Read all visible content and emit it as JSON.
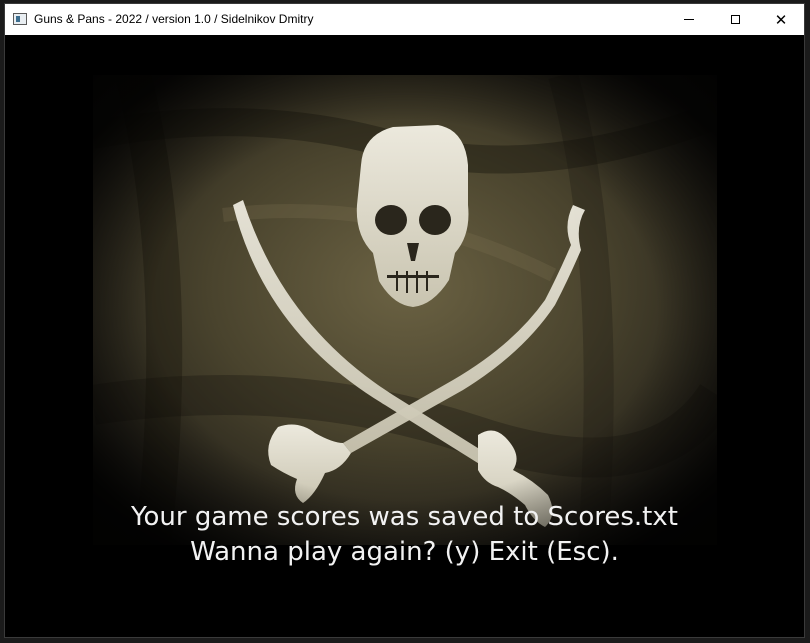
{
  "window": {
    "title": "Guns & Pans - 2022 / version 1.0 / Sidelnikov Dmitry",
    "icon": "app-window-icon",
    "controls": {
      "minimize_icon": "minimize-icon",
      "maximize_icon": "maximize-icon",
      "close_icon": "close-icon",
      "close_glyph": "✕"
    }
  },
  "game": {
    "background_image": "pirate-flag-jolly-roger",
    "message_line1": "Your game scores was saved to Scores.txt",
    "message_line2": "Wanna play again? (y) Exit (Esc).",
    "colors": {
      "background": "#000000",
      "text": "#f2f2f2",
      "flag_dark": "#1a1810",
      "flag_light": "#6b6243"
    }
  }
}
